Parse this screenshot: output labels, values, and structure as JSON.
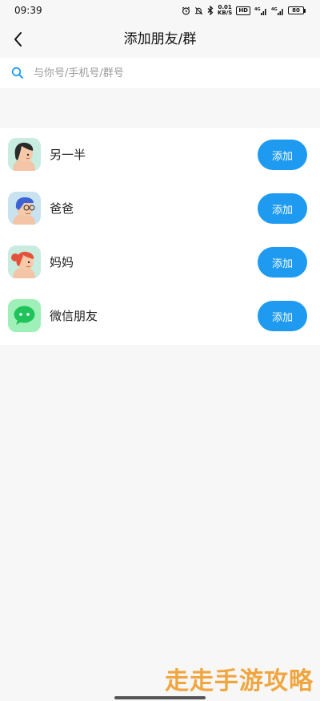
{
  "status_bar": {
    "time": "09:39",
    "net_speed_value": "0.01",
    "net_speed_unit": "KB/S",
    "hd_label": "HD",
    "signal_1": "4G",
    "signal_2": "4G",
    "battery_level": "80"
  },
  "header": {
    "title": "添加朋友/群",
    "back_icon": "chevron-left-icon"
  },
  "search": {
    "placeholder": "与你号/手机号/群号",
    "value": "",
    "icon": "search-icon"
  },
  "contacts": [
    {
      "label": "另一半",
      "button_label": "添加",
      "avatar": "woman-avatar-icon"
    },
    {
      "label": "爸爸",
      "button_label": "添加",
      "avatar": "man-glasses-avatar-icon"
    },
    {
      "label": "妈妈",
      "button_label": "添加",
      "avatar": "woman-red-hair-avatar-icon"
    },
    {
      "label": "微信朋友",
      "button_label": "添加",
      "avatar": "wechat-chat-icon"
    }
  ],
  "watermark": "走走手游攻略",
  "colors": {
    "accent": "#1e9bf0",
    "background": "#f7f7f7",
    "card": "#ffffff",
    "watermark": "#f0a640"
  }
}
